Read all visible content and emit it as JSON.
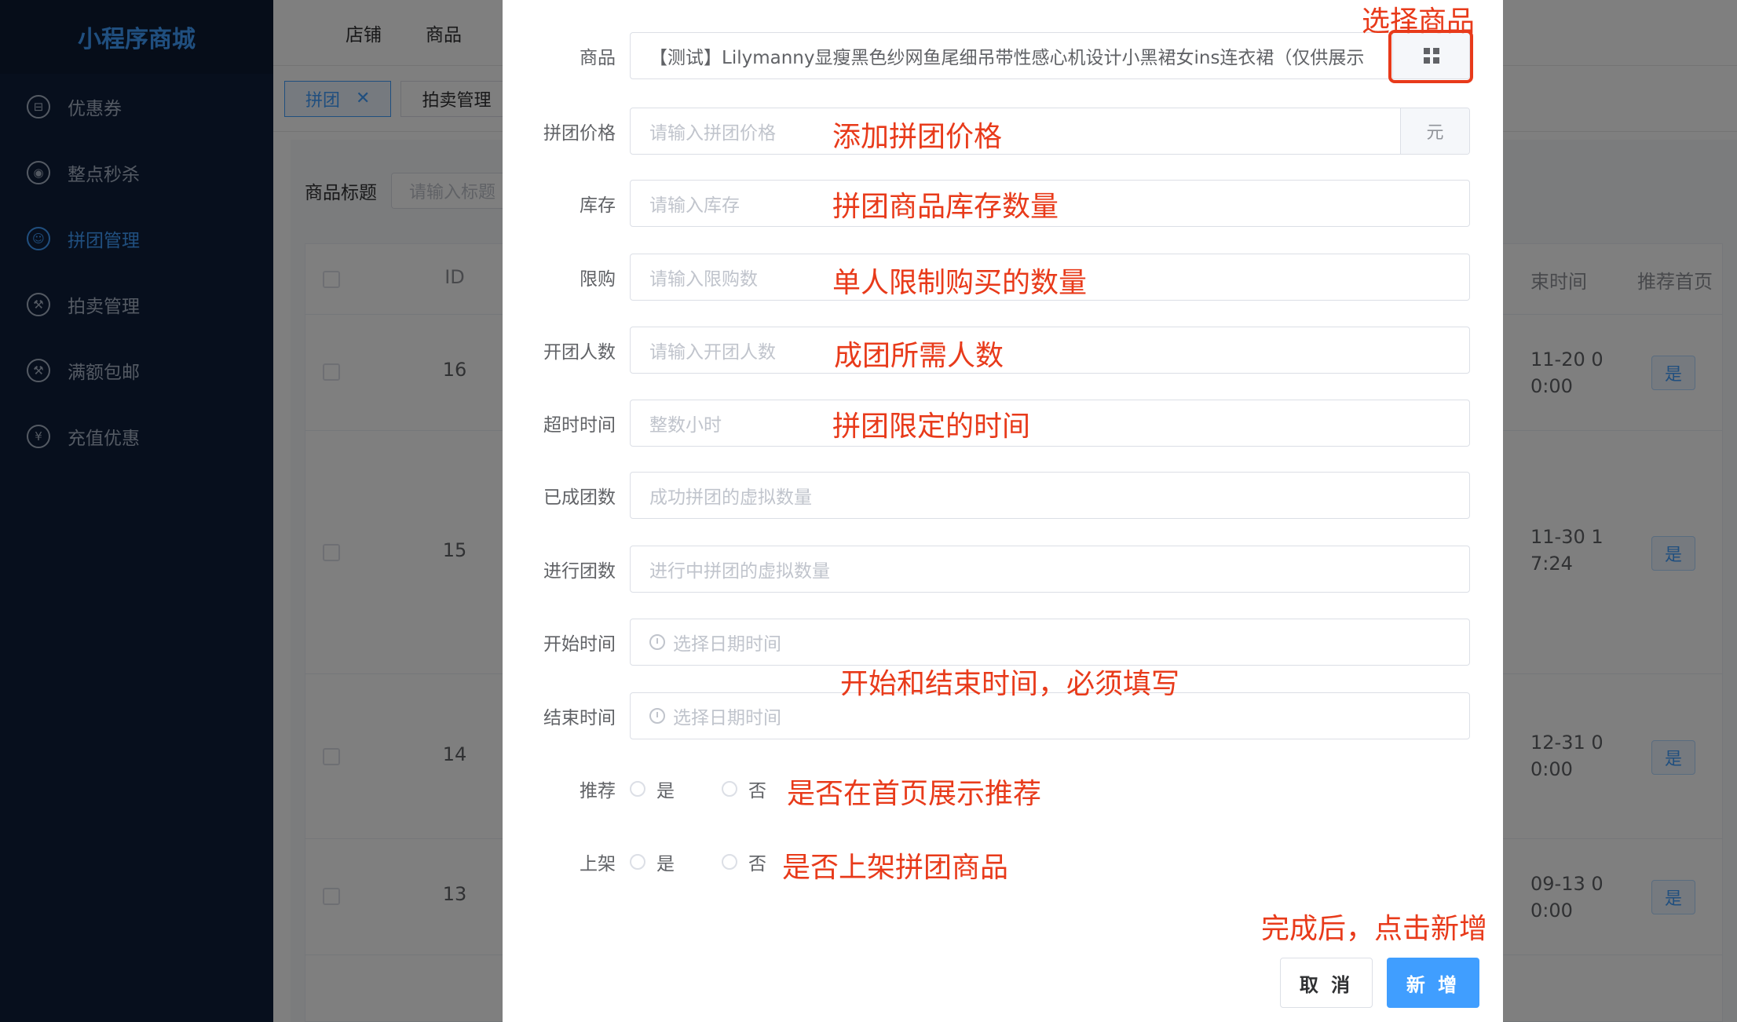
{
  "sidebar": {
    "logo": "小程序商城",
    "items": [
      {
        "label": "优惠券",
        "icon": "ticket-icon",
        "glyph": "⊟"
      },
      {
        "label": "整点秒杀",
        "icon": "gamepad-icon",
        "glyph": "◉"
      },
      {
        "label": "拼团管理",
        "icon": "users-icon",
        "glyph": "☺",
        "active": true
      },
      {
        "label": "拍卖管理",
        "icon": "gavel-icon",
        "glyph": "⚒"
      },
      {
        "label": "满额包邮",
        "icon": "gavel-icon",
        "glyph": "⚒"
      },
      {
        "label": "充值优惠",
        "icon": "yen-icon",
        "glyph": "¥"
      }
    ]
  },
  "topnav": {
    "items": [
      "店铺",
      "商品"
    ]
  },
  "tags": {
    "active": "拼团",
    "close": "✕",
    "other": "拍卖管理"
  },
  "filter": {
    "label": "商品标题",
    "placeholder": "请输入标题"
  },
  "table": {
    "headers": {
      "id": "ID",
      "time": "束时间",
      "recommend": "推荐首页"
    },
    "rows": [
      {
        "id": "16",
        "time1": "11-20 0",
        "time2": "0:00",
        "badge": "是"
      },
      {
        "id": "15",
        "time1": "11-30 1",
        "time2": "7:24",
        "badge": "是"
      },
      {
        "id": "14",
        "time1": "12-31 0",
        "time2": "0:00",
        "badge": "是"
      },
      {
        "id": "13",
        "time1": "09-13 0",
        "time2": "0:00",
        "badge": "是"
      }
    ]
  },
  "dialog": {
    "fields": {
      "product": {
        "label": "商品",
        "value": "【测试】Lilymanny显瘦黑色纱网鱼尾细吊带性感心机设计小黑裙女ins连衣裙（仅供展示"
      },
      "price": {
        "label": "拼团价格",
        "placeholder": "请输入拼团价格",
        "unit": "元"
      },
      "stock": {
        "label": "库存",
        "placeholder": "请输入库存"
      },
      "limit": {
        "label": "限购",
        "placeholder": "请输入限购数"
      },
      "group_size": {
        "label": "开团人数",
        "placeholder": "请输入开团人数"
      },
      "timeout": {
        "label": "超时时间",
        "placeholder": "整数小时"
      },
      "done_groups": {
        "label": "已成团数",
        "placeholder": "成功拼团的虚拟数量"
      },
      "ongoing_groups": {
        "label": "进行团数",
        "placeholder": "进行中拼团的虚拟数量"
      },
      "start_time": {
        "label": "开始时间",
        "placeholder": "选择日期时间"
      },
      "end_time": {
        "label": "结束时间",
        "placeholder": "选择日期时间"
      },
      "recommend": {
        "label": "推荐",
        "yes": "是",
        "no": "否"
      },
      "listed": {
        "label": "上架",
        "yes": "是",
        "no": "否"
      }
    },
    "buttons": {
      "cancel": "取 消",
      "submit": "新 增"
    }
  },
  "annotations": {
    "select_product": "选择商品",
    "price": "添加拼团价格",
    "stock": "拼团商品库存数量",
    "limit": "单人限制购买的数量",
    "group_size": "成团所需人数",
    "timeout": "拼团限定的时间",
    "time": "开始和结束时间，必须填写",
    "recommend": "是否在首页展示推荐",
    "listed": "是否上架拼团商品",
    "done": "完成后，点击新增"
  },
  "colors": {
    "accent": "#409eff",
    "annotation": "#e83a1a",
    "sidebar": "#0f1f3b"
  }
}
